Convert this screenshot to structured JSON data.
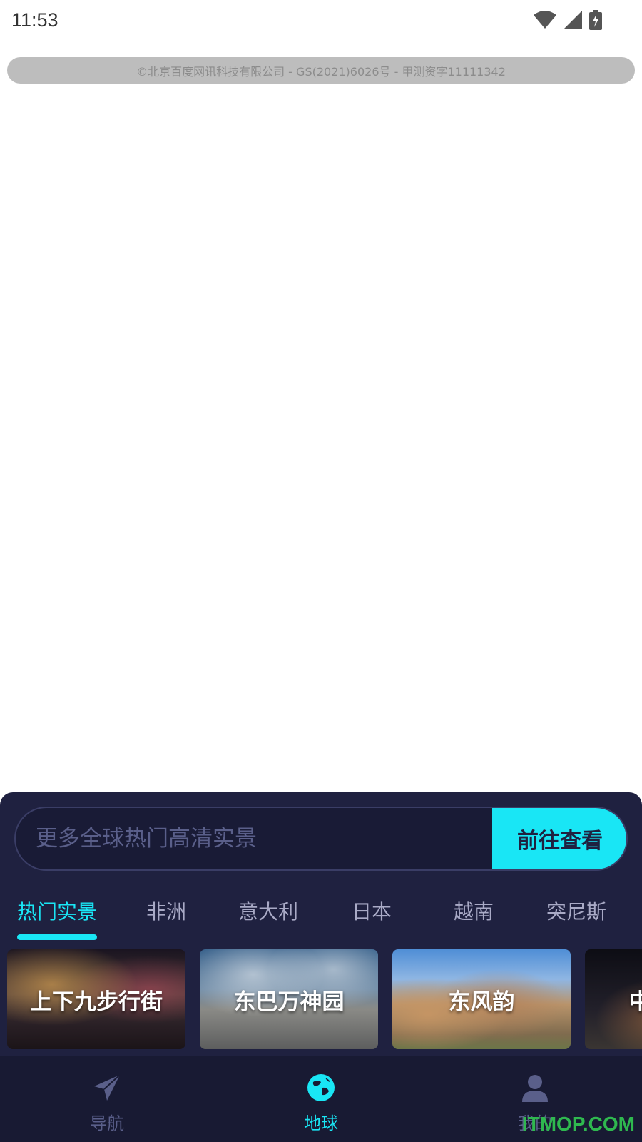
{
  "status_bar": {
    "time": "11:53",
    "icons": [
      "wifi-icon",
      "signal-icon",
      "battery-charging-icon"
    ]
  },
  "map": {
    "copyright": "©北京百度网讯科技有限公司 - GS(2021)6026号 - 甲测资字11111342"
  },
  "search": {
    "placeholder": "更多全球热门高清实景",
    "button_label": "前往查看"
  },
  "tabs": [
    {
      "label": "热门实景",
      "active": true
    },
    {
      "label": "非洲",
      "active": false
    },
    {
      "label": "意大利",
      "active": false
    },
    {
      "label": "日本",
      "active": false
    },
    {
      "label": "越南",
      "active": false
    },
    {
      "label": "突尼斯",
      "active": false
    }
  ],
  "cards": [
    {
      "label": "上下九步行街"
    },
    {
      "label": "东巴万神园"
    },
    {
      "label": "东风韵"
    },
    {
      "label": "中"
    }
  ],
  "bottom_nav": [
    {
      "label": "导航",
      "icon": "paper-plane-icon",
      "active": false
    },
    {
      "label": "地球",
      "icon": "globe-icon",
      "active": true
    },
    {
      "label": "我的",
      "icon": "user-icon",
      "active": false
    }
  ],
  "watermark": "ITMOP.COM",
  "colors": {
    "accent": "#19e6f5",
    "panel_bg": "#1f2140",
    "nav_bg": "#181a33",
    "inactive_text": "#a9aac6"
  }
}
